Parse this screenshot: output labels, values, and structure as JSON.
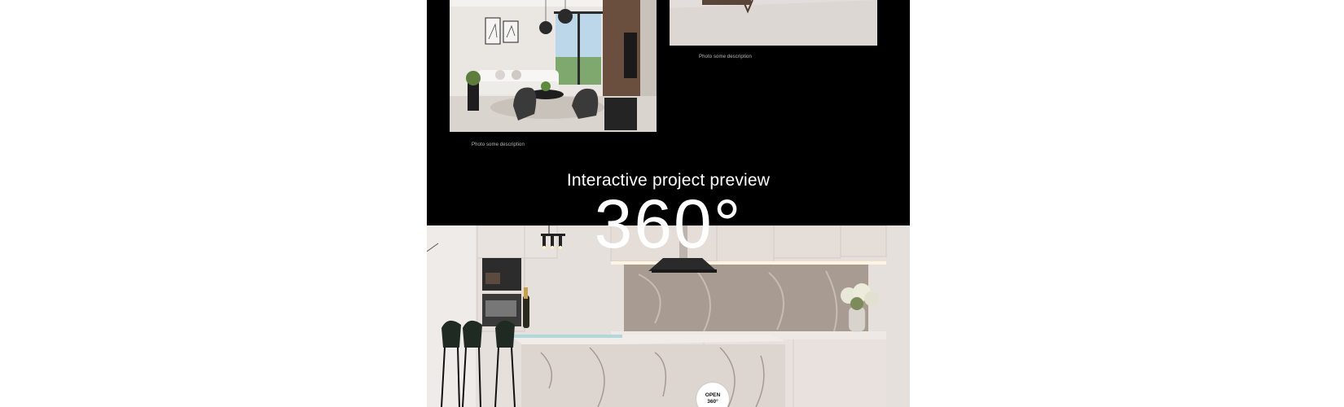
{
  "gallery": {
    "photos": [
      {
        "alt": "living-room",
        "caption": "Photo some description"
      },
      {
        "alt": "room-floor",
        "caption": "Photo some description"
      }
    ]
  },
  "preview": {
    "title": "Interactive project preview",
    "degrees": "360°",
    "open_button": {
      "line1": "OPEN",
      "line2": "360°"
    }
  },
  "colors": {
    "background": "#000000",
    "page": "#ffffff",
    "text": "#ffffff",
    "caption": "#bdbdbd"
  }
}
